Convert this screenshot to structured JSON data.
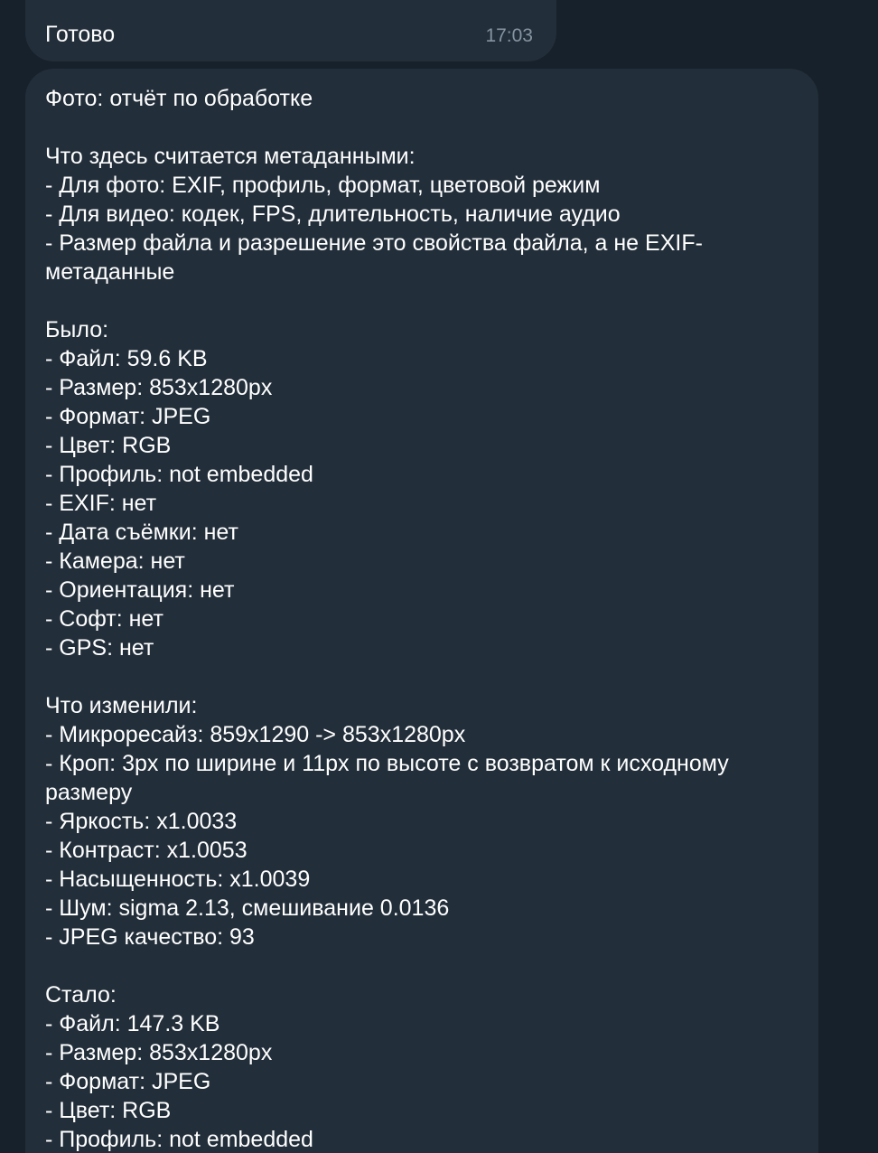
{
  "previous_message": {
    "text": "Готово",
    "time": "17:03"
  },
  "report_message": {
    "lines": [
      "Фото: отчёт по обработке",
      "",
      "Что здесь считается метаданными:",
      "- Для фото: EXIF, профиль, формат, цветовой режим",
      "- Для видео: кодек, FPS, длительность, наличие аудио",
      "- Размер файла и разрешение это свойства файла, а не EXIF-",
      "метаданные",
      "",
      "Было:",
      "- Файл: 59.6 KB",
      "- Размер: 853x1280px",
      "- Формат: JPEG",
      "- Цвет: RGB",
      "- Профиль: not embedded",
      "- EXIF: нет",
      "- Дата съёмки: нет",
      "- Камера: нет",
      "- Ориентация: нет",
      "- Софт: нет",
      "- GPS: нет",
      "",
      "Что изменили:",
      "- Микроресайз: 859x1290 -> 853x1280px",
      "- Кроп: 3px по ширине и 11px по высоте с возвратом к исходному",
      "размеру",
      "- Яркость: x1.0033",
      "- Контраст: x1.0053",
      "- Насыщенность: x1.0039",
      "- Шум: sigma 2.13, смешивание 0.0136",
      "- JPEG качество: 93",
      "",
      "Стало:",
      "- Файл: 147.3 KB",
      "- Размер: 853x1280px",
      "- Формат: JPEG",
      "- Цвет: RGB",
      "- Профиль: not embedded"
    ]
  },
  "colors": {
    "background": "#17212b",
    "bubble": "#222e3a",
    "text": "#ffffff",
    "timestamp": "#8694a1"
  }
}
